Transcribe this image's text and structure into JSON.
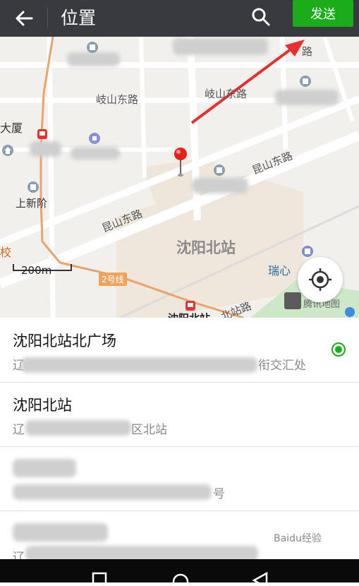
{
  "header": {
    "title": "位置",
    "send_label": "发送",
    "colors": {
      "bar": "#393a3f",
      "send": "#1aad19"
    }
  },
  "map": {
    "labels": {
      "road_qishan_left": "岐山东路",
      "road_qishan_right": "岐山东路",
      "building_dasha": "大厦",
      "metro_shangxinjie": "上新阶",
      "road_kunshan_right": "昆山东路",
      "road_kunshan_left": "昆山东路",
      "station_main": "沈阳北站",
      "ruixin": "瑞心",
      "station_bottom": "沈阳北站",
      "road_bei": "北站路",
      "school": "校",
      "label_right_top": "路",
      "tencent_map": "腾讯地图"
    },
    "scale_label": "200m",
    "line2_label": "2号线"
  },
  "results": [
    {
      "title": "沈阳北站北广场",
      "subtitle_start": "辽",
      "subtitle_end": "衔交汇处",
      "selected": true
    },
    {
      "title": "沈阳北站",
      "subtitle_start": "辽",
      "subtitle_end": "区北站",
      "selected": false
    },
    {
      "title": "",
      "subtitle_start": "",
      "subtitle_end": "号",
      "selected": false
    },
    {
      "title": "",
      "subtitle_start": "辽",
      "subtitle_end": "",
      "selected": false
    }
  ],
  "watermark": "Baidu经验"
}
